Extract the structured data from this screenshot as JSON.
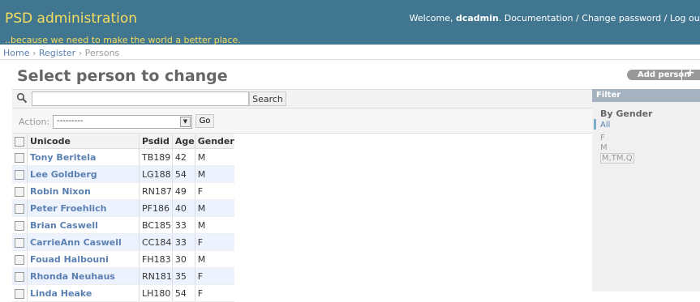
{
  "header": {
    "brand": "PSD administration",
    "tagline": "..because we need to make the world a better place.",
    "welcome": "Welcome,",
    "username": "dcadmin",
    "after_username": ".",
    "documentation": "Documentation",
    "sep1": "/",
    "change_password": "Change password",
    "sep2": "/",
    "logout": "Log out"
  },
  "breadcrumbs": {
    "home": "Home",
    "sep1": "›",
    "register": "Register",
    "sep2": "›",
    "current": "Persons"
  },
  "page_title": "Select person to change",
  "add_button": {
    "label": "Add person",
    "icon": "plus-icon"
  },
  "search": {
    "value": "",
    "button": "Search",
    "icon": "search-icon"
  },
  "actions": {
    "label": "Action:",
    "selected": "---------",
    "go": "Go"
  },
  "table": {
    "headers": [
      "Unicode",
      "Psdid",
      "Age",
      "Gender"
    ],
    "rows": [
      {
        "name": "Tony Beritela",
        "psdid": "TB189",
        "age": "42",
        "gender": "M"
      },
      {
        "name": "Lee Goldberg",
        "psdid": "LG188",
        "age": "54",
        "gender": "M"
      },
      {
        "name": "Robin Nixon",
        "psdid": "RN187",
        "age": "49",
        "gender": "F"
      },
      {
        "name": "Peter Froehlich",
        "psdid": "PF186",
        "age": "40",
        "gender": "M"
      },
      {
        "name": "Brian Caswell",
        "psdid": "BC185",
        "age": "33",
        "gender": "M"
      },
      {
        "name": "CarrieAnn Caswell",
        "psdid": "CC184",
        "age": "33",
        "gender": "F"
      },
      {
        "name": "Fouad Halbouni",
        "psdid": "FH183",
        "age": "30",
        "gender": "M"
      },
      {
        "name": "Rhonda Neuhaus",
        "psdid": "RN181",
        "age": "35",
        "gender": "F"
      },
      {
        "name": "Linda Heake",
        "psdid": "LH180",
        "age": "54",
        "gender": "F"
      }
    ]
  },
  "filter": {
    "title": "Filter",
    "by": "By Gender",
    "options": [
      "All",
      "F",
      "M",
      "M,TM,Q"
    ],
    "selected": "All"
  },
  "colors": {
    "header_bg": "#417690",
    "brand": "#f5dd5d",
    "link": "#5b80b2",
    "row_alt": "#edf3fe",
    "filter_header": "#a5b3c0"
  }
}
